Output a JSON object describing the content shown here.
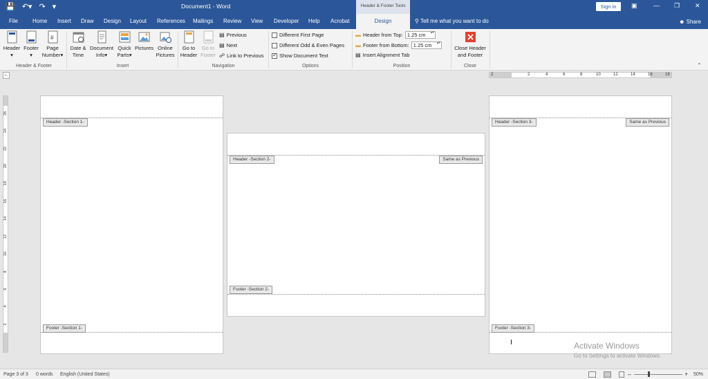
{
  "titlebar": {
    "document_title": "Document1  -  Word",
    "context_title": "Header & Footer Tools",
    "sign_in": "Sign in"
  },
  "tabs": [
    "File",
    "Home",
    "Insert",
    "Draw",
    "Design",
    "Layout",
    "References",
    "Mailings",
    "Review",
    "View",
    "Developer",
    "Help",
    "Acrobat"
  ],
  "active_tab": "Design",
  "tell_me": "Tell me what you want to do",
  "share": "Share",
  "ribbon": {
    "header_footer_group": {
      "label": "Header & Footer",
      "header": "Header",
      "footer": "Footer",
      "page_number_line1": "Page",
      "page_number_line2": "Number"
    },
    "insert_group": {
      "label": "Insert",
      "date_time_line1": "Date &",
      "date_time_line2": "Time",
      "doc_info_line1": "Document",
      "doc_info_line2": "Info",
      "quick_parts_line1": "Quick",
      "quick_parts_line2": "Parts",
      "pictures": "Pictures",
      "online_pictures_line1": "Online",
      "online_pictures_line2": "Pictures"
    },
    "navigation_group": {
      "label": "Navigation",
      "go_to_header_line1": "Go to",
      "go_to_header_line2": "Header",
      "go_to_footer_line1": "Go to",
      "go_to_footer_line2": "Footer",
      "previous": "Previous",
      "next": "Next",
      "link_to_previous": "Link to Previous"
    },
    "options_group": {
      "label": "Options",
      "different_first_page": "Different First Page",
      "different_odd_even": "Different Odd & Even Pages",
      "show_document_text": "Show Document Text"
    },
    "position_group": {
      "label": "Position",
      "header_from_top_label": "Header from Top:",
      "header_from_top_value": "1.25 cm",
      "footer_from_bottom_label": "Footer from Bottom:",
      "footer_from_bottom_value": "1.25 cm",
      "insert_alignment_tab": "Insert Alignment Tab"
    },
    "close_group": {
      "label": "Close",
      "close_line1": "Close Header",
      "close_line2": "and Footer"
    }
  },
  "rulers": {
    "horizontal_ticks": [
      "2",
      "2",
      "4",
      "6",
      "8",
      "10",
      "12",
      "14",
      "16",
      "18"
    ],
    "vertical_ticks": [
      "26",
      "24",
      "22",
      "20",
      "18",
      "16",
      "14",
      "12",
      "10",
      "8",
      "6",
      "4",
      "2"
    ]
  },
  "pages": {
    "page1": {
      "header_tag": "Header -Section 1-",
      "footer_tag": "Footer -Section 1-"
    },
    "page2": {
      "header_tag": "Header -Section 2-",
      "same_as_previous": "Same as Previous",
      "footer_tag": "Footer -Section 2-"
    },
    "page3": {
      "header_tag": "Header -Section 3-",
      "same_as_previous": "Same as Previous",
      "footer_tag": "Footer -Section 3-"
    }
  },
  "watermark": {
    "line1": "Activate Windows",
    "line2": "Go to Settings to activate Windows."
  },
  "statusbar": {
    "page_info": "Page 3 of 3",
    "words": "0 words",
    "language": "English (United States)",
    "zoom": "50%"
  },
  "colors": {
    "accent": "#2b579a",
    "ribbon_bg": "#f3f3f3",
    "workspace_bg": "#e6e6e6",
    "close_red": "#e0422f"
  }
}
